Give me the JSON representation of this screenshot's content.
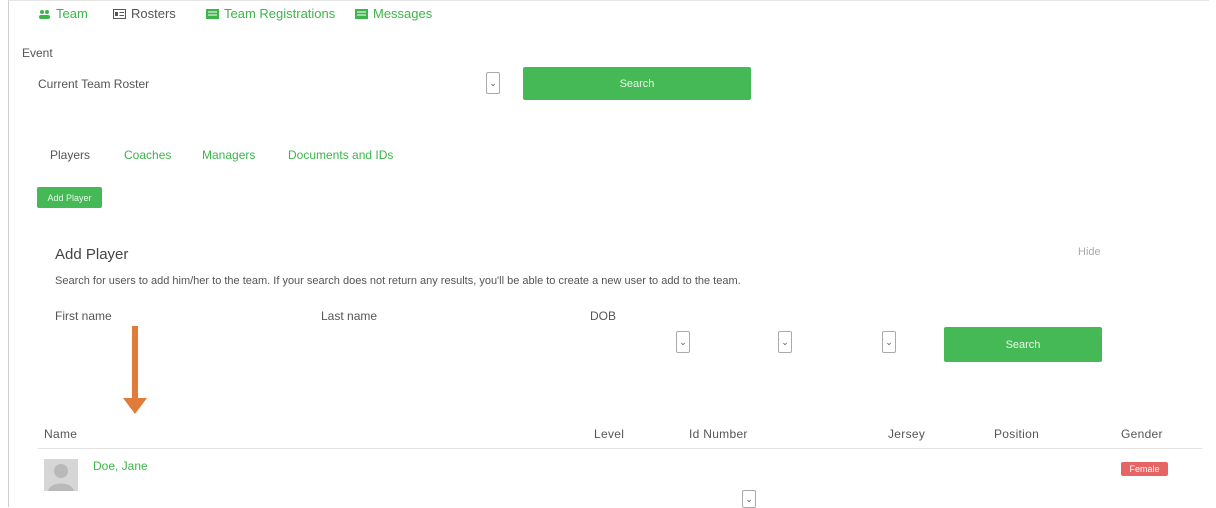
{
  "nav": {
    "items": [
      {
        "label": "Team",
        "icon": "group-icon",
        "color": "#3cb54a"
      },
      {
        "label": "Rosters",
        "icon": "id-card-icon",
        "color": "#555555"
      },
      {
        "label": "Team Registrations",
        "icon": "list-icon",
        "color": "#3cb54a"
      },
      {
        "label": "Messages",
        "icon": "list-icon",
        "color": "#3cb54a"
      }
    ]
  },
  "event": {
    "label": "Event",
    "selected": "Current Team Roster",
    "search_label": "Search"
  },
  "tabs": [
    {
      "label": "Players",
      "active": true
    },
    {
      "label": "Coaches",
      "active": false
    },
    {
      "label": "Managers",
      "active": false
    },
    {
      "label": "Documents and IDs",
      "active": false
    }
  ],
  "add_player_button": "Add Player",
  "add_player_panel": {
    "title": "Add Player",
    "hide_label": "Hide",
    "description": "Search for users to add him/her to the team. If your search does not return any results, you'll be able to create a new user to add to the team.",
    "first_name_label": "First name",
    "last_name_label": "Last name",
    "dob_label": "DOB",
    "search_label": "Search"
  },
  "table": {
    "headers": [
      "Name",
      "Level",
      "Id Number",
      "Jersey",
      "Position",
      "Gender"
    ],
    "rows": [
      {
        "name": "Doe, Jane",
        "gender": "Female"
      }
    ]
  },
  "colors": {
    "accent": "#3cb54a",
    "button": "#45b955",
    "badge_female": "#e86464",
    "annotation_arrow": "#e07b39"
  }
}
